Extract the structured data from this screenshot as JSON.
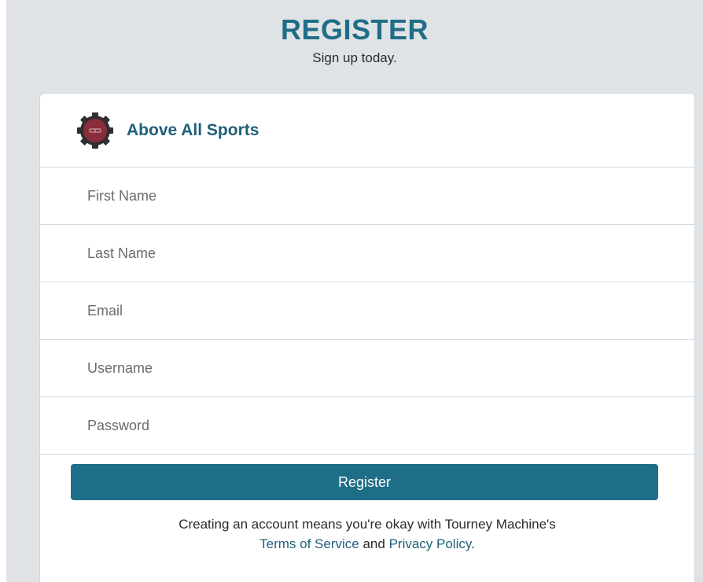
{
  "header": {
    "title": "REGISTER",
    "subtitle": "Sign up today."
  },
  "organization": {
    "name": "Above All Sports",
    "logo_icon": "gear-badge-icon",
    "logo_colors": {
      "gear": "#2f2f2f",
      "badge": "#8a2d3b"
    }
  },
  "form": {
    "fields": [
      {
        "name": "first-name",
        "placeholder": "First Name",
        "value": ""
      },
      {
        "name": "last-name",
        "placeholder": "Last Name",
        "value": ""
      },
      {
        "name": "email",
        "placeholder": "Email",
        "value": ""
      },
      {
        "name": "username",
        "placeholder": "Username",
        "value": ""
      },
      {
        "name": "password",
        "placeholder": "Password",
        "value": ""
      }
    ],
    "submit_label": "Register"
  },
  "terms": {
    "prefix": "Creating an account means you're okay with Tourney Machine's",
    "tos_label": "Terms of Service",
    "and_text": " and ",
    "privacy_label": "Privacy Policy",
    "suffix": "."
  },
  "colors": {
    "accent": "#1f6e87",
    "background": "#e0e3e6",
    "card": "#ffffff"
  }
}
